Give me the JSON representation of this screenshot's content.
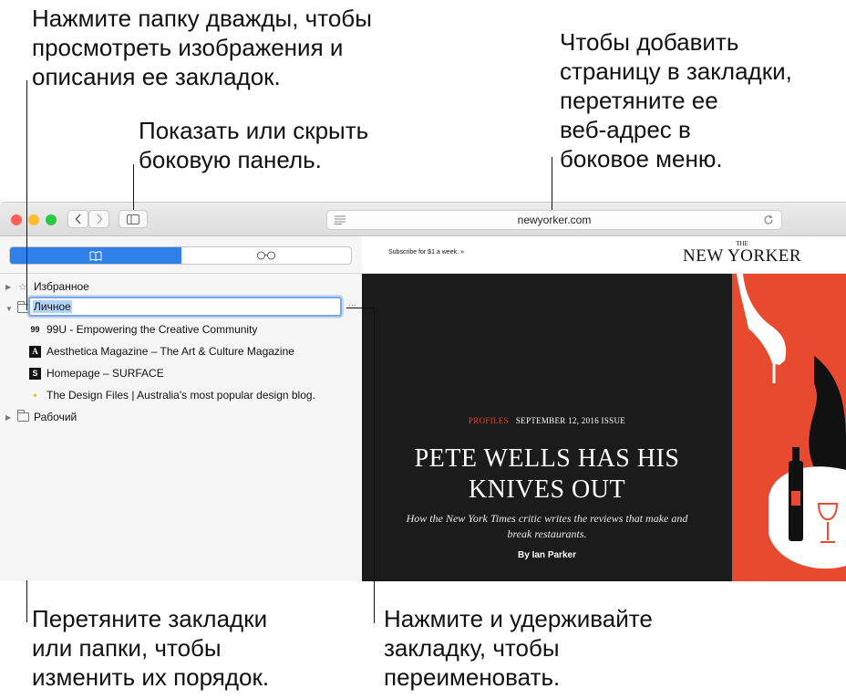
{
  "callouts": {
    "folder_dbl_click": "Нажмите папку дважды, чтобы\nпросмотреть изображения и\nописания ее закладок.",
    "add_bookmark": "Чтобы добавить\nстраницу в закладки,\nперетяните ее\nвеб-адрес в\nбоковое меню.",
    "toggle_sidebar": "Показать или скрыть\nбоковую панель.",
    "drag_reorder": "Перетяните закладки\nили папки, чтобы\nизменить их порядок.",
    "press_hold_rename": "Нажмите и удерживайте\nзакладку, чтобы\nпереименовать."
  },
  "browser": {
    "url": "newyorker.com",
    "tab_bookmarks_icon": "book-icon",
    "tab_reading_list_icon": "glasses-icon",
    "more_label": "···"
  },
  "sidebar": {
    "favorites": "Избранное",
    "personal": "Личное",
    "work": "Рабочий",
    "bookmarks": [
      {
        "icon": "99",
        "label": "99U - Empowering the Creative Community"
      },
      {
        "icon": "A",
        "label": "Aesthetica Magazine – The Art & Culture Magazine"
      },
      {
        "icon": "S",
        "label": "Homepage – SURFACE"
      },
      {
        "icon": "•",
        "label": "The Design Files | Australia's most popular design blog."
      }
    ]
  },
  "page": {
    "subscribe": "Subscribe for $1 a week. »",
    "logo_top": "THE",
    "logo_main": "NEW YORKER",
    "section": "PROFILES",
    "issue": "SEPTEMBER 12, 2016 ISSUE",
    "headline_1": "PETE WELLS HAS HIS",
    "headline_2": "KNIVES OUT",
    "dek": "How the New York Times critic writes the reviews that make and break restaurants.",
    "byline": "By Ian Parker"
  },
  "colors": {
    "accent_blue": "#2f7fe9",
    "ny_red": "#e84a2f",
    "hero_dark": "#1b1b1b"
  }
}
